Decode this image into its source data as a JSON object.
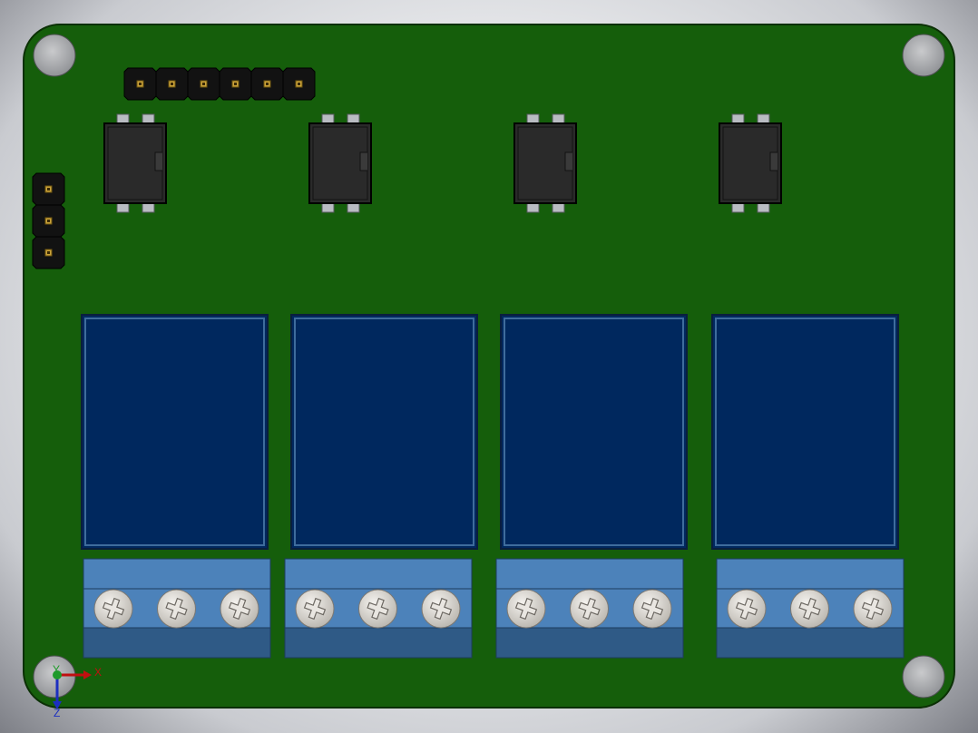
{
  "colors": {
    "pcb_green": "#155e0b",
    "pcb_edge": "#0b3005",
    "relay_blue": "#00285e",
    "relay_edge": "#3e6c9c",
    "terminal_blue": "#4c82ba",
    "terminal_dark": "#2f5a86",
    "chip_black": "#2a2a2a",
    "header_black": "#121212",
    "screw_gray": "#d9d6d1"
  },
  "triad": {
    "x_label": "X",
    "y_label": "Y",
    "z_label": "Z"
  },
  "components": {
    "mounting_holes": 4,
    "header_pins_horizontal": 6,
    "header_pins_vertical": 3,
    "optocouplers": 4,
    "relays": 4,
    "terminal_blocks": 4,
    "screws_per_terminal": 3
  }
}
